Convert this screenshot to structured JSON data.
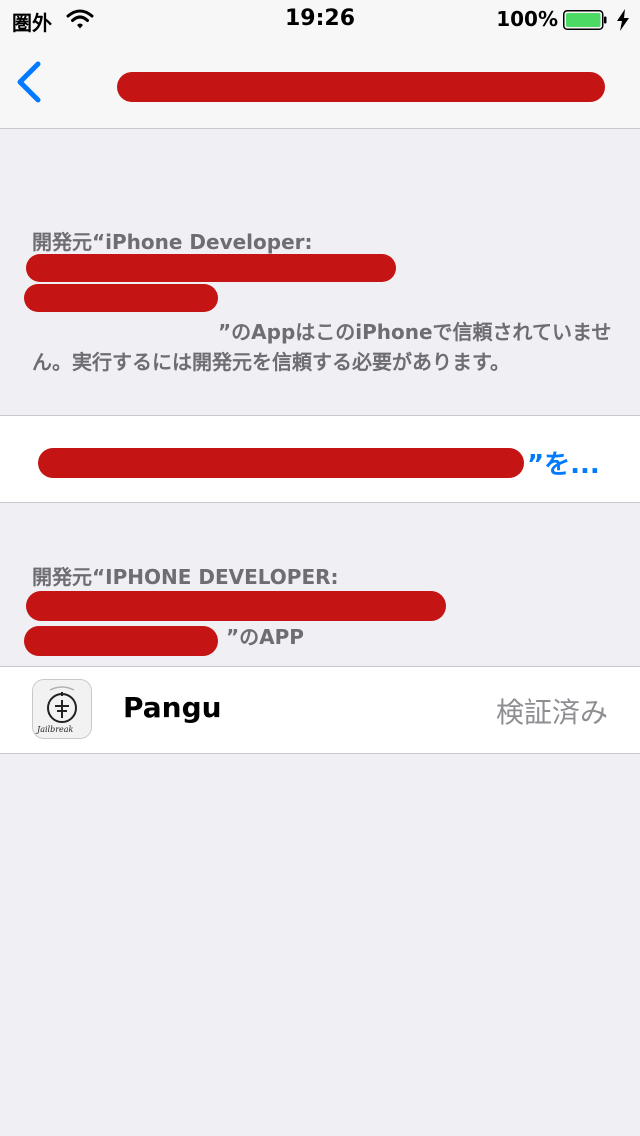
{
  "status_bar": {
    "carrier": "圏外",
    "time": "19:26",
    "battery": "100%"
  },
  "icons": {
    "wifi": "wifi-icon",
    "battery": "battery-icon",
    "charging": "charging-bolt-icon",
    "back": "chevron-left-icon",
    "app": "pangu-jailbreak-icon"
  },
  "colors": {
    "accent": "#007aff",
    "battery_fill": "#4cd964",
    "redaction": "#c41414",
    "background": "#efeff4"
  },
  "trust_section": {
    "header_prefix": "開発元“iPhone Developer:",
    "header_suffix": "”のAppはこのiPhoneで信頼されていません。実行するには開発元を信頼する必要があります。",
    "trust_action_suffix": "”を..."
  },
  "apps_section": {
    "header_prefix": "開発元“IPHONE DEVELOPER:",
    "header_suffix": "”のAPP",
    "app_icon_text": "Jailbreak",
    "apps": [
      {
        "name": "Pangu",
        "status": "検証済み"
      }
    ]
  }
}
